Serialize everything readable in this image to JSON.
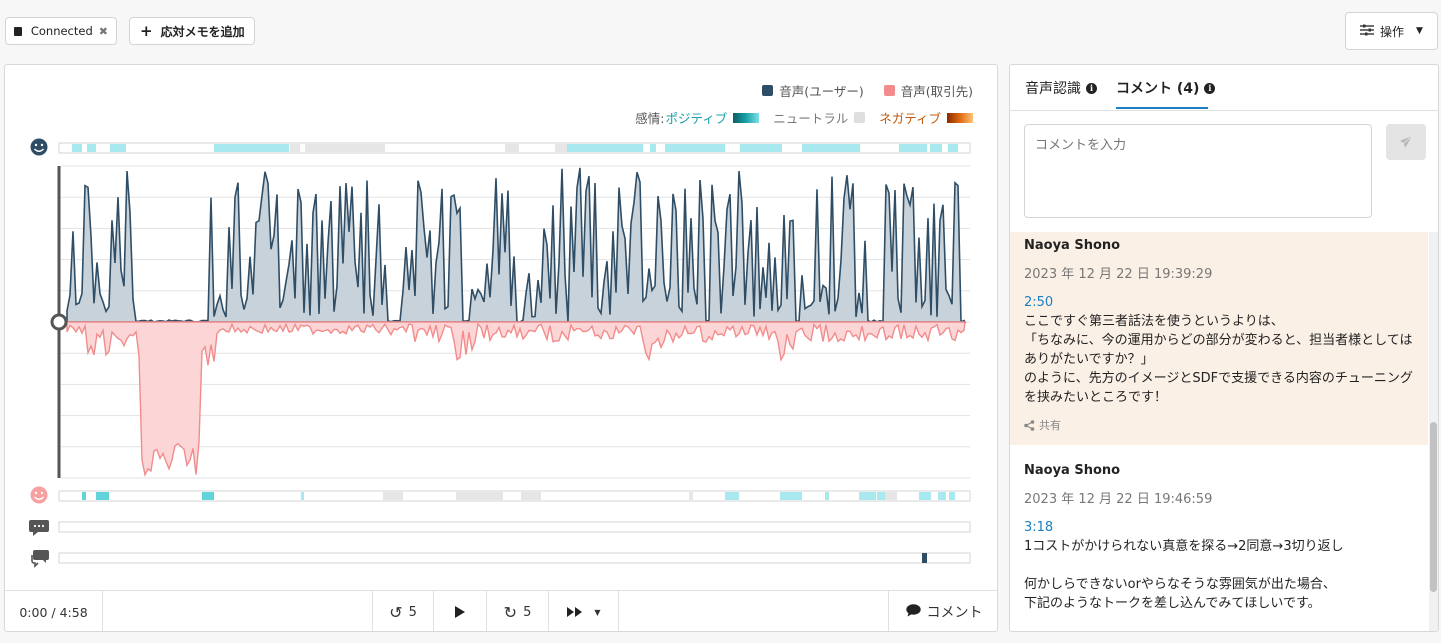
{
  "header": {
    "connected_label": "Connected",
    "add_memo_label": "応対メモを追加",
    "operations_label": "操作"
  },
  "legend": {
    "user_voice": "音声(ユーザー)",
    "client_voice": "音声(取引先)",
    "emotion_prefix": "感情:",
    "positive": "ポジティブ",
    "neutral": "ニュートラル",
    "negative": "ネガティブ"
  },
  "colors": {
    "user_wave": "#2f4e66",
    "user_fill": "#c8d2da",
    "client_wave": "#f28c8c",
    "client_fill": "#fcd6d6",
    "positive": "#1aa1a8",
    "neutral": "#dedede",
    "negative": "#d2691e",
    "accent": "#1b7fc4"
  },
  "player": {
    "time_display": "0:00 / 4:58",
    "rewind_label": "5",
    "forward_label": "5",
    "comment_label": "コメント"
  },
  "sidebar": {
    "tab_speech": "音声認識",
    "tab_comments": "コメント (4)",
    "comment_placeholder": "コメントを入力"
  },
  "comments": [
    {
      "author": "Naoya Shono",
      "date": "2023 年 12 月 22 日 19:39:29",
      "time": "2:50",
      "body": "ここですぐ第三者話法を使うというよりは、\n「ちなみに、今の運用からどの部分が変わると、担当者様としてはありがたいですか？」\nのように、先方のイメージとSDFで支援できる内容のチューニングを挟みたいところです！",
      "share_label": "共有"
    },
    {
      "author": "Naoya Shono",
      "date": "2023 年 12 月 22 日 19:46:59",
      "time": "3:18",
      "body": "1コストがかけられない真意を探る→2同意→3切り返し\n\n何かしらできないorやらなそうな雰囲気が出た場合、\n下記のようなトークを差し込んでみてほしいです。",
      "share_label": ""
    }
  ]
}
